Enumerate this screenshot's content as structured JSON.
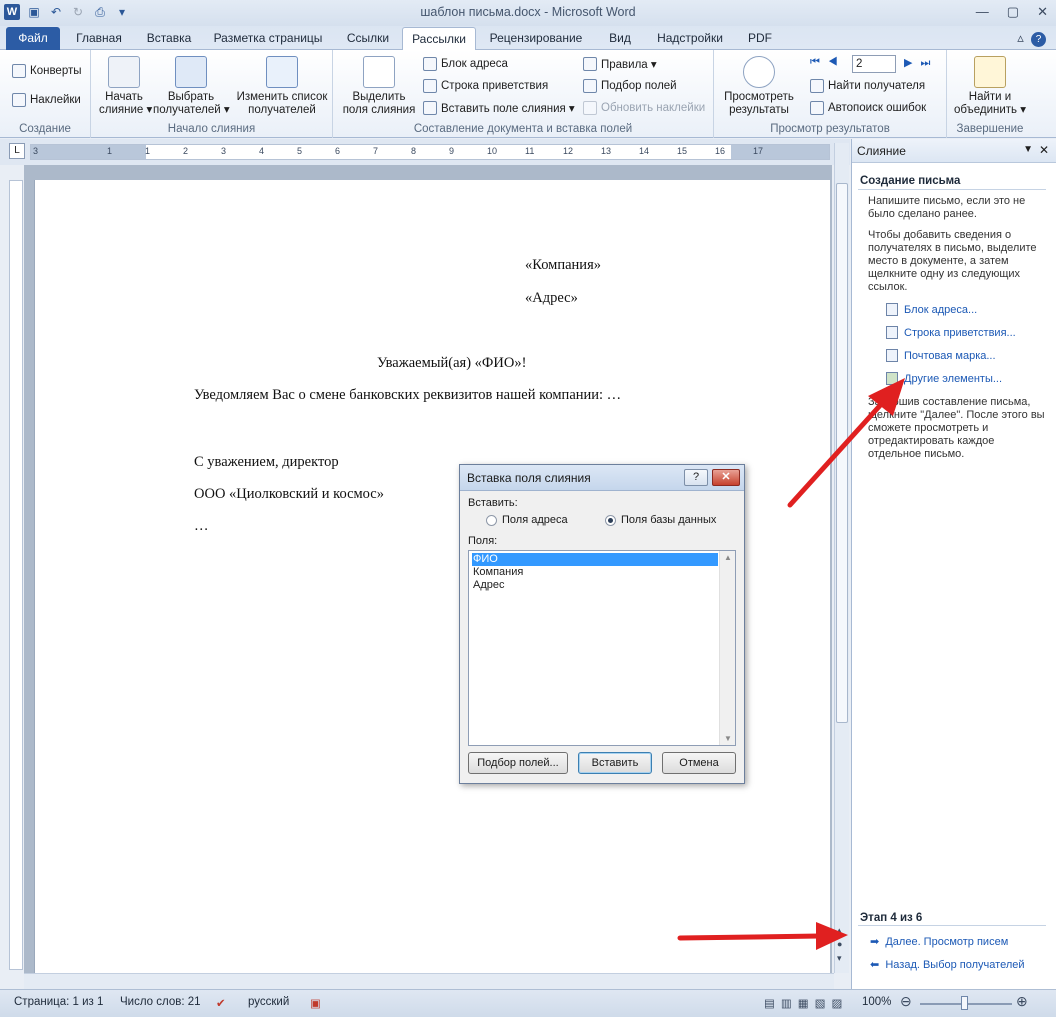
{
  "window": {
    "title": "шаблон письма.docx - Microsoft Word"
  },
  "tabs": [
    "Файл",
    "Главная",
    "Вставка",
    "Разметка страницы",
    "Ссылки",
    "Рассылки",
    "Рецензирование",
    "Вид",
    "Надстройки",
    "PDF"
  ],
  "ribbon": {
    "create": {
      "label": "Создание",
      "envelopes": "Конверты",
      "labels": "Наклейки"
    },
    "start": {
      "label": "Начало слияния",
      "start_merge": "Начать\nслияние ▾",
      "select_recipients": "Выбрать\nполучателей ▾",
      "edit_list": "Изменить список\nполучателей"
    },
    "compose": {
      "label": "Составление документа и вставка полей",
      "highlight": "Выделить\nполя слияния",
      "address_block": "Блок адреса",
      "greeting_line": "Строка приветствия",
      "insert_field": "Вставить поле слияния ▾",
      "rules": "Правила ▾",
      "match_fields": "Подбор полей",
      "update_labels": "Обновить наклейки"
    },
    "preview": {
      "label": "Просмотр результатов",
      "preview_results": "Просмотреть\nрезультаты",
      "record": "2",
      "find_recipient": "Найти получателя",
      "auto_check": "Автопоиск ошибок"
    },
    "finish": {
      "label": "Завершение",
      "finish_merge": "Найти и\nобъединить ▾"
    }
  },
  "ruler": {
    "numbers": [
      "3",
      "1",
      "1",
      "2",
      "3",
      "4",
      "5",
      "6",
      "7",
      "8",
      "9",
      "10",
      "11",
      "12",
      "13",
      "14",
      "15",
      "16",
      "17"
    ]
  },
  "document": {
    "company": "«Компания»",
    "address": "«Адрес»",
    "greeting": "Уважаемый(ая)  «ФИО»!",
    "body": "Уведомляем Вас о смене банковских реквизитов нашей компании: …",
    "sign1": "С уважением, директор",
    "sign2": "ООО «Циолковский и космос»",
    "sign3": "…"
  },
  "dialog": {
    "title": "Вставка поля слияния",
    "insert_label": "Вставить:",
    "opt_address": "Поля адреса",
    "opt_database": "Поля базы данных",
    "fields_label": "Поля:",
    "fields": [
      "ФИО",
      "Компания",
      "Адрес"
    ],
    "selected_field": "ФИО",
    "btn_match": "Подбор полей...",
    "btn_insert": "Вставить",
    "btn_cancel": "Отмена"
  },
  "pane": {
    "title": "Слияние",
    "heading": "Создание письма",
    "p1": "Напишите письмо, если это не было сделано ранее.",
    "p2": "Чтобы добавить сведения о получателях в письмо, выделите место в документе, а затем щелкните одну из следующих ссылок.",
    "links": [
      "Блок адреса...",
      "Строка приветствия...",
      "Почтовая марка...",
      "Другие элементы..."
    ],
    "p3": "Завершив составление письма, щелкните \"Далее\". После этого вы сможете просмотреть и отредактировать каждое отдельное письмо.",
    "step": "Этап 4 из 6",
    "next": "Далее. Просмотр писем",
    "back": "Назад. Выбор получателей"
  },
  "status": {
    "page": "Страница: 1 из 1",
    "words": "Число слов: 21",
    "lang": "русский",
    "zoom": "100%"
  },
  "colors": {
    "accent": "#2c5ca5",
    "link": "#1c59b5",
    "arrow": "#e02020"
  }
}
